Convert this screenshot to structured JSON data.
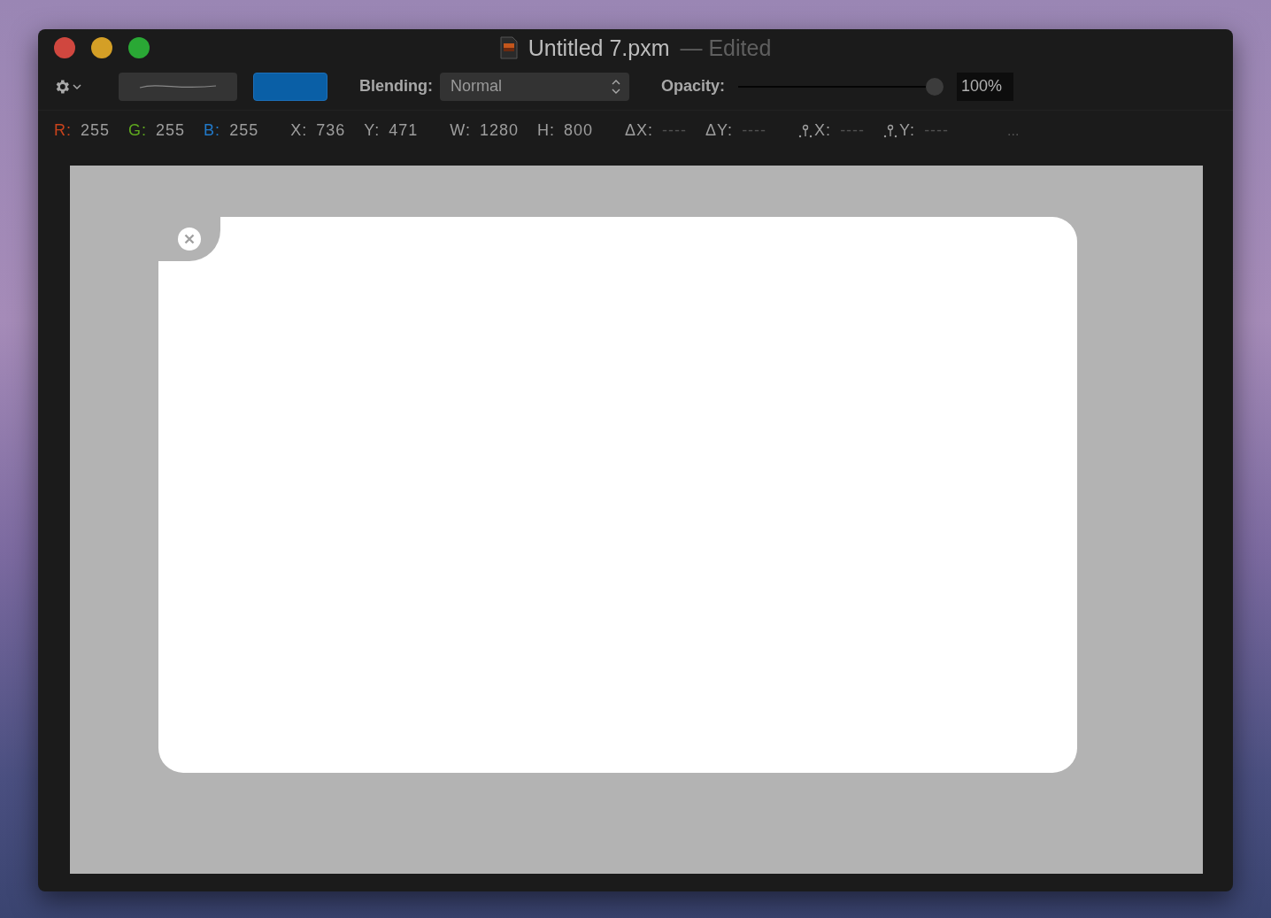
{
  "window": {
    "title": "Untitled 7.pxm",
    "status": "— Edited"
  },
  "toolbar": {
    "blending": {
      "label": "Blending:",
      "value": "Normal"
    },
    "opacity": {
      "label": "Opacity:",
      "level": 1,
      "value": "100%"
    }
  },
  "info_groups": [
    [
      {
        "kind": "color",
        "label": "R:",
        "value": "255",
        "color": "#c9431c"
      },
      {
        "kind": "color",
        "label": "G:",
        "value": "255",
        "color": "#5fa81f"
      },
      {
        "kind": "color",
        "label": "B:",
        "value": "255",
        "color": "#2179c9"
      }
    ],
    [
      {
        "kind": "plain",
        "label": "X:",
        "value": "736"
      },
      {
        "kind": "plain",
        "label": "Y:",
        "value": "471"
      }
    ],
    [
      {
        "kind": "plain",
        "label": "W:",
        "value": "1280"
      },
      {
        "kind": "plain",
        "label": "H:",
        "value": "800"
      }
    ],
    [
      {
        "kind": "plain",
        "label": "ΔX:",
        "value": "----"
      },
      {
        "kind": "plain",
        "label": "ΔY:",
        "value": "----"
      }
    ],
    [
      {
        "kind": "anchor",
        "label": "X:",
        "value": "----"
      },
      {
        "kind": "anchor",
        "label": "Y:",
        "value": "----"
      }
    ],
    [
      {
        "kind": "more",
        "label": "..."
      }
    ]
  ]
}
